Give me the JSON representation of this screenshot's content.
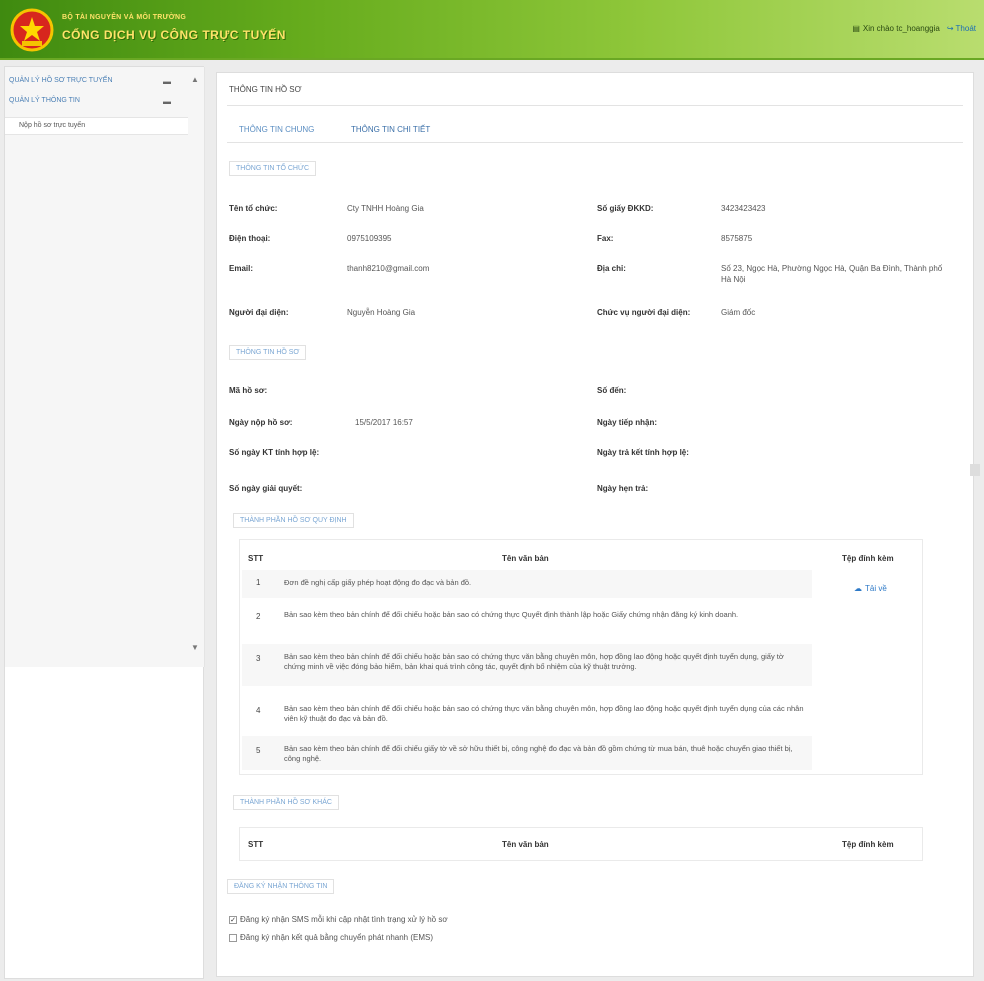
{
  "header": {
    "brand_small": "BỘ TÀI NGUYÊN VÀ MÔI TRƯỜNG",
    "brand_large": "CỔNG DỊCH VỤ CÔNG TRỰC TUYẾN",
    "greeting": "Xin chào tc_hoanggia",
    "logout": "Thoát"
  },
  "sidebar": {
    "items": [
      {
        "label": "QUẢN LÝ HỒ SƠ TRỰC TUYẾN"
      },
      {
        "label": "QUẢN LÝ THÔNG TIN"
      }
    ],
    "sub_item": "Nộp hồ sơ trực tuyến"
  },
  "main": {
    "title": "THÔNG TIN HỒ SƠ",
    "tabs": [
      "THÔNG TIN CHUNG",
      "THÔNG TIN CHI TIẾT"
    ],
    "org_section": "THÔNG TIN TỔ CHỨC",
    "org": {
      "name_label": "Tên tổ chức:",
      "name_value": "Cty TNHH Hoàng Gia",
      "gdkd_label": "Số giấy ĐKKD:",
      "gdkd_value": "3423423423",
      "phone_label": "Điện thoại:",
      "phone_value": "0975109395",
      "fax_label": "Fax:",
      "fax_value": "8575875",
      "email_label": "Email:",
      "email_value": "thanh8210@gmail.com",
      "address_label": "Địa chỉ:",
      "address_value": "Số 23, Ngọc Hà, Phường Ngọc Hà, Quận Ba Đình, Thành phố Hà Nội",
      "rep_label": "Người đại diện:",
      "rep_value": "Nguyễn Hoàng Gia",
      "position_label": "Chức vụ người đại diện:",
      "position_value": "Giám đốc"
    },
    "file_section": "THÔNG TIN HỒ SƠ",
    "file": {
      "code_label": "Mã hồ sơ:",
      "number_label": "Số đến:",
      "submit_label": "Ngày nộp hồ sơ:",
      "submit_value": "15/5/2017 16:57",
      "receive_label": "Ngày tiếp nhận:",
      "days_label": "Số ngày KT tính hợp lệ:",
      "return_label": "Ngày trả kết tính hợp lệ:",
      "process_label": "Số ngày giải quyết:",
      "deadline_label": "Ngày hẹn trả:"
    },
    "docs_section": "THÀNH PHẦN HỒ SƠ QUY ĐỊNH",
    "docs_headers": {
      "stt": "STT",
      "name": "Tên văn bản",
      "attach": "Tệp đính kèm"
    },
    "docs": [
      {
        "stt": "1",
        "text": "Đơn đề nghị cấp giấy phép hoạt động đo đạc và bản đồ."
      },
      {
        "stt": "2",
        "text": "Bản sao kèm theo bản chính để đối chiếu hoặc bản sao có chứng thực Quyết định thành lập hoặc Giấy chứng nhận đăng ký kinh doanh."
      },
      {
        "stt": "3",
        "text": "Bản sao kèm theo bản chính để đối chiếu hoặc bản sao có chứng thực văn bằng chuyên môn, hợp đồng lao động hoặc quyết định tuyển dụng, giấy tờ chứng minh về việc đóng bảo hiểm, bản khai quá trình công tác, quyết định bổ nhiệm của kỹ thuật trưởng."
      },
      {
        "stt": "4",
        "text": "Bản sao kèm theo bản chính để đối chiếu hoặc bản sao có chứng thực văn bằng chuyên môn, hợp đồng lao động hoặc quyết định tuyển dụng của các nhân viên kỹ thuật đo đạc và bản đồ."
      },
      {
        "stt": "5",
        "text": "Bản sao kèm theo bản chính để đối chiếu giấy tờ về sở hữu thiết bị, công nghệ đo đạc và bản đồ gồm chứng từ mua bán, thuê hoặc chuyển giao thiết bị, công nghệ."
      }
    ],
    "attach_label": "Tải về",
    "other_section": "THÀNH PHẦN HỒ SƠ KHÁC",
    "other_headers": {
      "stt": "STT",
      "name": "Tên văn bản",
      "attach": "Tệp đính kèm"
    },
    "reg_section": "ĐĂNG KÝ NHẬN THÔNG TIN",
    "reg_options": [
      {
        "label": "Đăng ký nhận SMS mỗi khi cập nhật tình trạng xử lý hồ sơ",
        "checked": true
      },
      {
        "label": "Đăng ký nhận kết quả bằng chuyển phát nhanh (EMS)",
        "checked": false
      }
    ]
  }
}
